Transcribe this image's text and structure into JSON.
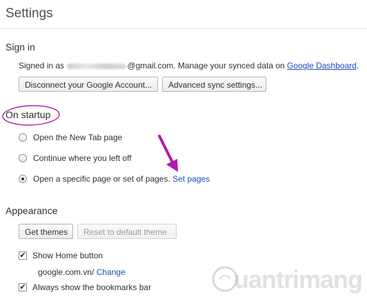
{
  "page": {
    "title": "Settings"
  },
  "sign_in": {
    "heading": "Sign in",
    "prefix": "Signed in as",
    "email_suffix": "@gmail.com. Manage your synced data on",
    "dashboard_link": "Google Dashboard",
    "period": ".",
    "disconnect_button": "Disconnect your Google Account...",
    "advanced_sync_button": "Advanced sync settings..."
  },
  "startup": {
    "heading": "On startup",
    "options": [
      {
        "label": "Open the New Tab page",
        "selected": false
      },
      {
        "label": "Continue where you left off",
        "selected": false
      },
      {
        "label": "Open a specific page or set of pages.",
        "selected": true
      }
    ],
    "set_pages_link": "Set pages"
  },
  "appearance": {
    "heading": "Appearance",
    "get_themes_button": "Get themes",
    "reset_theme_button": "Reset to default theme",
    "show_home_label": "Show Home button",
    "home_url": "google.com.vn/",
    "change_link": "Change",
    "bookmarks_bar_label": "Always show the bookmarks bar"
  },
  "watermark": {
    "text": "uantrimang"
  },
  "colors": {
    "link": "#1a4bbf",
    "annotation": "#b01aa8"
  }
}
